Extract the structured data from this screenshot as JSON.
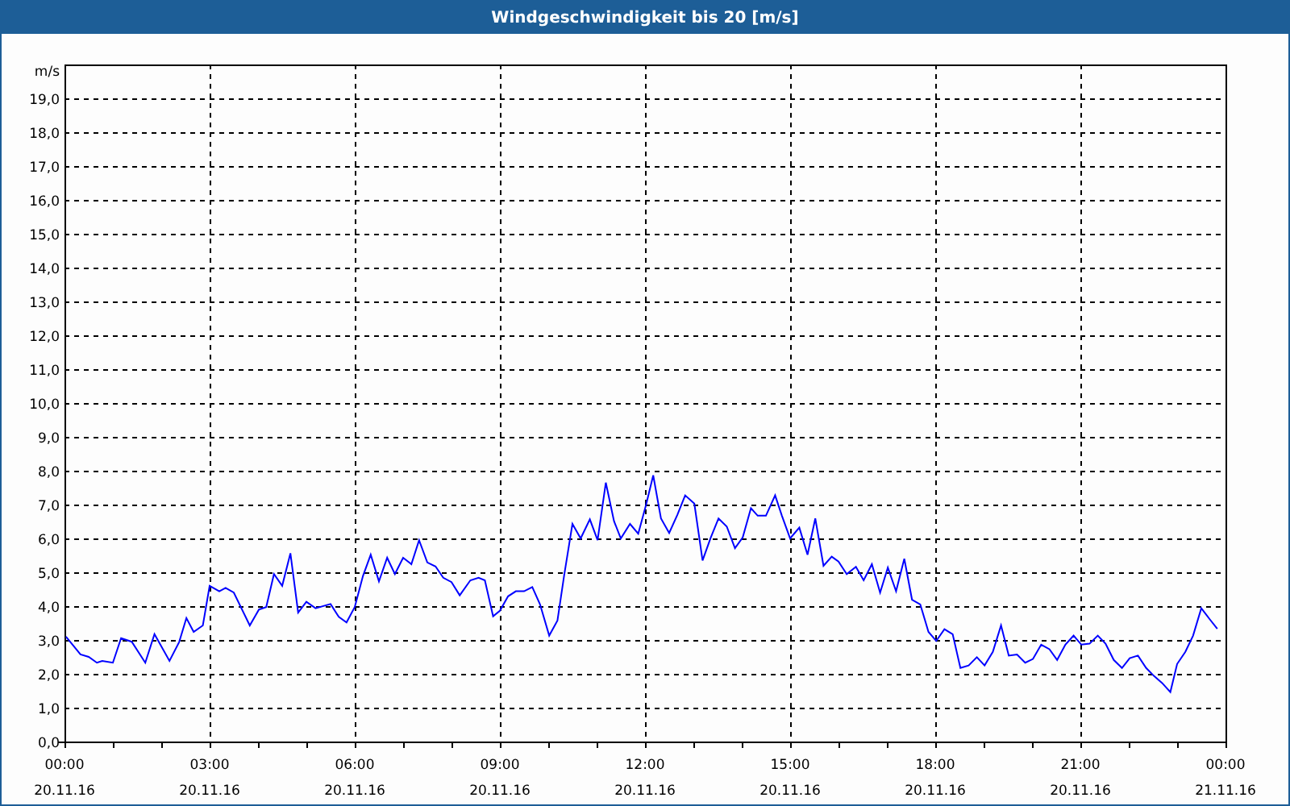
{
  "window": {
    "title": "Windgeschwindigkeit bis 20 [m/s]"
  },
  "chart": {
    "chart_data": {
      "type": "line",
      "grid": true,
      "ylabel": "m/s",
      "xlim": [
        0,
        24
      ],
      "ylim": [
        0,
        20
      ],
      "yticks": [
        {
          "value": 0,
          "label": "0,0"
        },
        {
          "value": 1,
          "label": "1,0"
        },
        {
          "value": 2,
          "label": "2,0"
        },
        {
          "value": 3,
          "label": "3,0"
        },
        {
          "value": 4,
          "label": "4,0"
        },
        {
          "value": 5,
          "label": "5,0"
        },
        {
          "value": 6,
          "label": "6,0"
        },
        {
          "value": 7,
          "label": "7,0"
        },
        {
          "value": 8,
          "label": "8,0"
        },
        {
          "value": 9,
          "label": "9,0"
        },
        {
          "value": 10,
          "label": "10,0"
        },
        {
          "value": 11,
          "label": "11,0"
        },
        {
          "value": 12,
          "label": "12,0"
        },
        {
          "value": 13,
          "label": "13,0"
        },
        {
          "value": 14,
          "label": "14,0"
        },
        {
          "value": 15,
          "label": "15,0"
        },
        {
          "value": 16,
          "label": "16,0"
        },
        {
          "value": 17,
          "label": "17,0"
        },
        {
          "value": 18,
          "label": "18,0"
        },
        {
          "value": 19,
          "label": "19,0"
        }
      ],
      "xticks": [
        {
          "value": 0,
          "label": "00:00"
        },
        {
          "value": 3,
          "label": "03:00"
        },
        {
          "value": 6,
          "label": "06:00"
        },
        {
          "value": 9,
          "label": "09:00"
        },
        {
          "value": 12,
          "label": "12:00"
        },
        {
          "value": 15,
          "label": "15:00"
        },
        {
          "value": 18,
          "label": "18:00"
        },
        {
          "value": 21,
          "label": "21:00"
        },
        {
          "value": 24,
          "label": "00:00"
        }
      ],
      "x": [
        0.03,
        0.33,
        0.5,
        0.67,
        0.78,
        1.0,
        1.17,
        1.39,
        1.67,
        1.86,
        2.17,
        2.37,
        2.52,
        2.67,
        2.86,
        3.0,
        3.2,
        3.33,
        3.5,
        3.83,
        4.02,
        4.17,
        4.33,
        4.5,
        4.67,
        4.83,
        5.0,
        5.19,
        5.5,
        5.67,
        5.83,
        6.0,
        6.17,
        6.33,
        6.5,
        6.67,
        6.83,
        7.0,
        7.17,
        7.33,
        7.5,
        7.67,
        7.83,
        8.0,
        8.17,
        8.39,
        8.56,
        8.69,
        8.86,
        9.0,
        9.17,
        9.33,
        9.5,
        9.67,
        9.83,
        10.02,
        10.19,
        10.33,
        10.5,
        10.67,
        10.86,
        11.02,
        11.19,
        11.36,
        11.5,
        11.69,
        11.86,
        12.02,
        12.17,
        12.33,
        12.5,
        12.67,
        12.83,
        13.02,
        13.19,
        13.36,
        13.52,
        13.69,
        13.86,
        14.02,
        14.19,
        14.33,
        14.5,
        14.69,
        14.83,
        15.0,
        15.19,
        15.36,
        15.52,
        15.69,
        15.86,
        16.0,
        16.17,
        16.36,
        16.52,
        16.69,
        16.86,
        17.02,
        17.19,
        17.36,
        17.52,
        17.69,
        17.86,
        18.02,
        18.19,
        18.36,
        18.52,
        18.69,
        18.86,
        19.02,
        19.19,
        19.36,
        19.52,
        19.69,
        19.86,
        20.02,
        20.19,
        20.36,
        20.52,
        20.69,
        20.86,
        21.02,
        21.19,
        21.36,
        21.52,
        21.69,
        21.86,
        22.02,
        22.19,
        22.36,
        22.52,
        22.69,
        22.86,
        23.0,
        23.17,
        23.33,
        23.5,
        23.67,
        23.83
      ],
      "series": [
        {
          "color": "#0000ff",
          "values": [
            3.1,
            2.57,
            2.5,
            2.33,
            2.38,
            2.33,
            3.05,
            2.95,
            2.33,
            3.17,
            2.38,
            2.94,
            3.65,
            3.24,
            3.43,
            4.6,
            4.44,
            4.54,
            4.4,
            3.43,
            3.9,
            3.97,
            4.95,
            4.6,
            5.56,
            3.81,
            4.13,
            3.94,
            4.06,
            3.68,
            3.52,
            3.97,
            4.89,
            5.52,
            4.73,
            5.43,
            4.95,
            5.43,
            5.24,
            5.95,
            5.29,
            5.17,
            4.84,
            4.71,
            4.32,
            4.76,
            4.84,
            4.76,
            3.7,
            3.86,
            4.29,
            4.44,
            4.44,
            4.56,
            4.05,
            3.13,
            3.57,
            4.92,
            6.43,
            6.0,
            6.56,
            5.95,
            7.65,
            6.51,
            6.0,
            6.43,
            6.14,
            6.98,
            7.86,
            6.59,
            6.16,
            6.7,
            7.27,
            7.03,
            5.35,
            6.03,
            6.59,
            6.35,
            5.71,
            6.03,
            6.89,
            6.67,
            6.67,
            7.27,
            6.67,
            6.0,
            6.32,
            5.52,
            6.59,
            5.19,
            5.46,
            5.32,
            4.95,
            5.16,
            4.76,
            5.24,
            4.4,
            5.14,
            4.44,
            5.4,
            4.19,
            4.05,
            3.24,
            2.97,
            3.32,
            3.17,
            2.17,
            2.25,
            2.49,
            2.25,
            2.65,
            3.43,
            2.54,
            2.57,
            2.33,
            2.44,
            2.86,
            2.73,
            2.41,
            2.86,
            3.13,
            2.86,
            2.89,
            3.13,
            2.89,
            2.41,
            2.17,
            2.46,
            2.54,
            2.17,
            1.94,
            1.73,
            1.46,
            2.29,
            2.65,
            3.13,
            3.94,
            3.62,
            3.33
          ]
        }
      ]
    },
    "date_labels": [
      "20.11.16",
      "20.11.16",
      "20.11.16",
      "20.11.16",
      "20.11.16",
      "20.11.16",
      "20.11.16",
      "20.11.16",
      "21.11.16"
    ]
  }
}
